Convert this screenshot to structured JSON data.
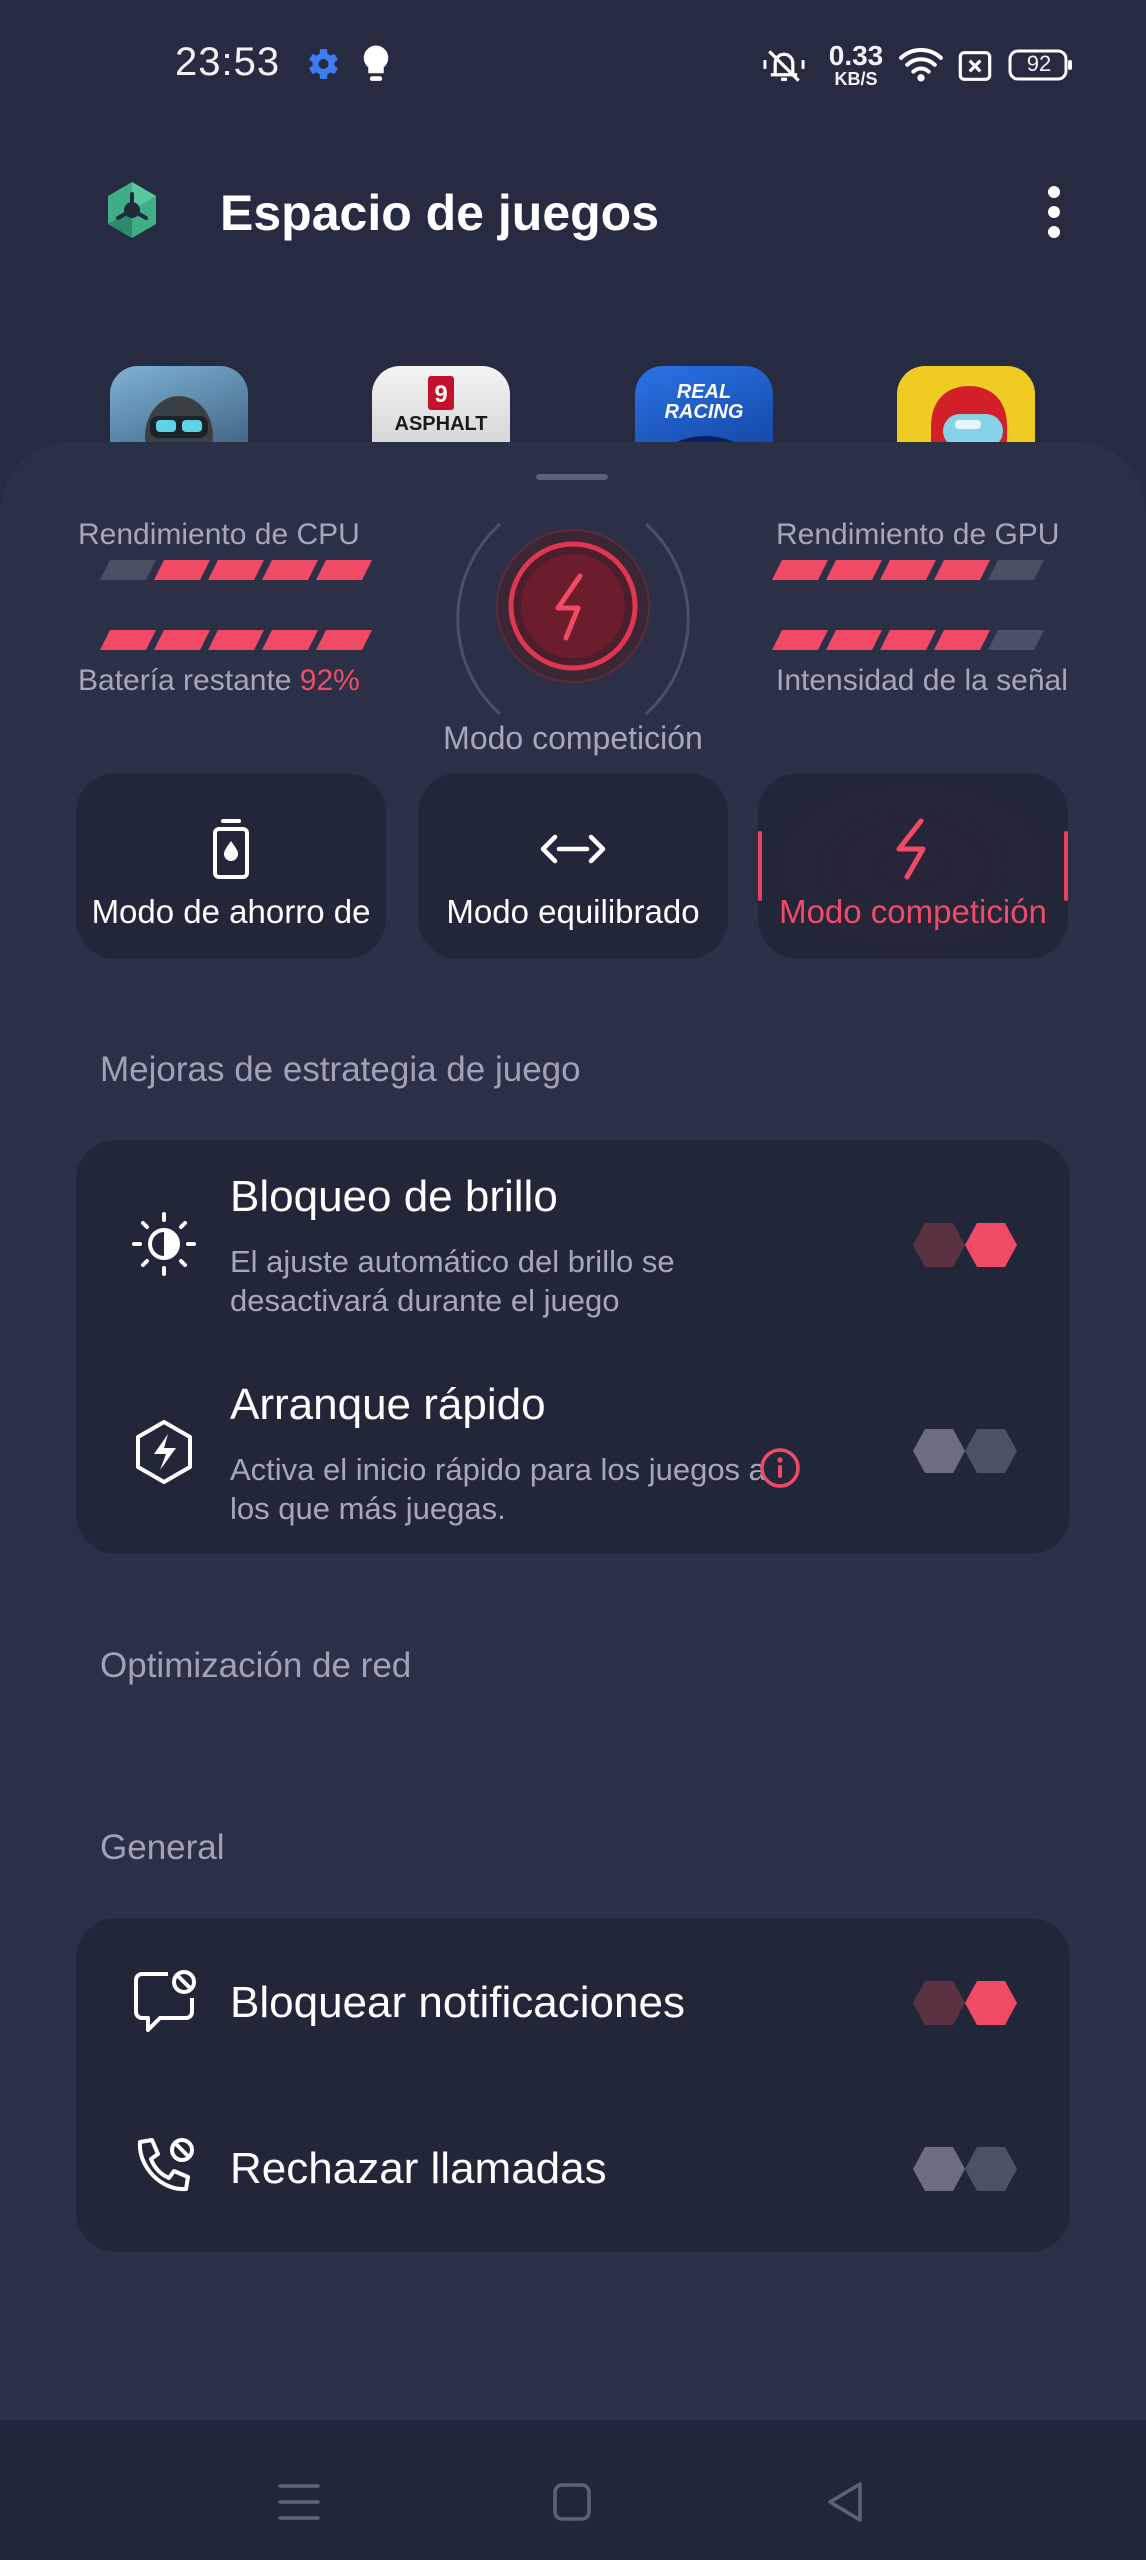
{
  "status_bar": {
    "time": "23:53",
    "net_speed_value": "0.33",
    "net_speed_unit": "KB/S",
    "battery": "92",
    "icons": [
      "gear-icon",
      "bulb-icon",
      "mute-bell-icon",
      "wifi-icon",
      "sim-off-icon",
      "battery-icon"
    ]
  },
  "header": {
    "title": "Espacio de juegos",
    "logo": "game-space-logo",
    "menu_icon": "more-vert-icon"
  },
  "games": [
    {
      "name": "call-of-duty-icon"
    },
    {
      "name": "asphalt-9-icon",
      "badge": "9",
      "text": "ASPHALT"
    },
    {
      "name": "real-racing-icon",
      "text1": "REAL",
      "text2": "RACING"
    },
    {
      "name": "among-us-icon"
    }
  ],
  "performance": {
    "cpu_label": "Rendimiento de CPU",
    "gpu_label": "Rendimiento de GPU",
    "battery_label": "Batería restante ",
    "battery_value": "92%",
    "signal_label": "Intensidad de la señal",
    "cpu_level": 4,
    "battery_level": 5,
    "gpu_level": 4,
    "signal_level": 4,
    "bar_segments": 5,
    "current_mode": "Modo competición"
  },
  "modes": [
    {
      "label": "Modo de ahorro de",
      "icon": "battery-drop-icon",
      "active": false
    },
    {
      "label": "Modo equilibrado",
      "icon": "balance-arrows-icon",
      "active": false
    },
    {
      "label": "Modo competición",
      "icon": "lightning-icon",
      "active": true
    }
  ],
  "sections": {
    "strategy": "Mejoras de estrategia de juego",
    "network": "Optimización de red",
    "general": "General"
  },
  "strategy_items": [
    {
      "title": "Bloqueo de brillo",
      "desc": "El ajuste automático del brillo se desactivará durante el juego",
      "icon": "brightness-icon",
      "enabled": true
    },
    {
      "title": "Arranque rápido",
      "desc": "Activa el inicio rápido para los juegos a los que más juegas.",
      "icon": "quick-start-icon",
      "enabled": false,
      "info_icon": "info-icon"
    }
  ],
  "general_items": [
    {
      "title": "Bloquear notificaciones",
      "icon": "block-notifications-icon",
      "enabled": true
    },
    {
      "title": "Rechazar llamadas",
      "icon": "reject-calls-icon",
      "enabled": false
    }
  ],
  "colors": {
    "accent": "#f14a66",
    "background": "#262b41",
    "card": "#222639"
  },
  "nav_bar": [
    "menu-icon",
    "home-icon",
    "back-icon"
  ]
}
